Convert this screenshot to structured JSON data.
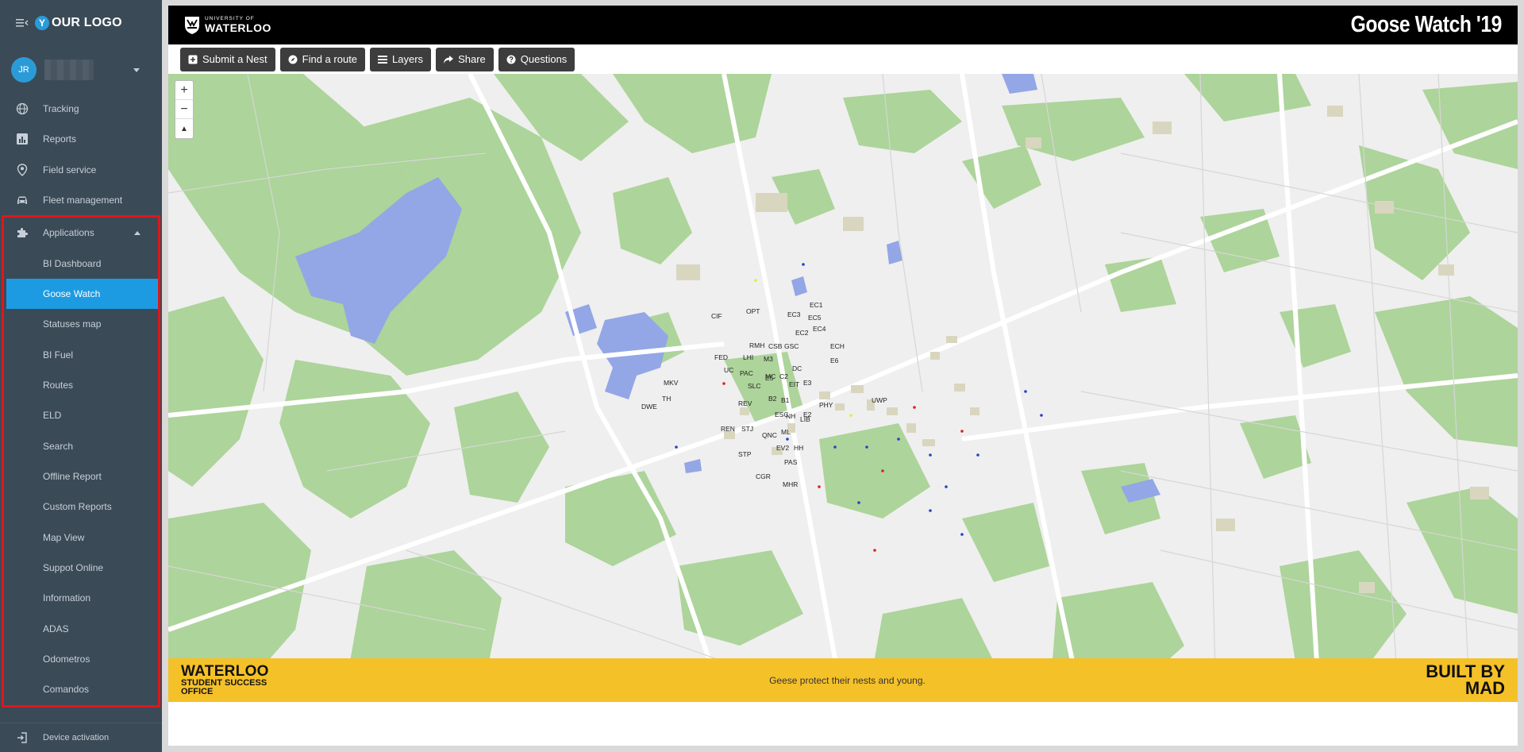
{
  "brand": {
    "logo_letter": "Y",
    "logo_text": "OUR LOGO"
  },
  "user": {
    "initials": "JR"
  },
  "nav": {
    "top_items": [
      {
        "label": "Tracking",
        "icon": "globe-icon"
      },
      {
        "label": "Reports",
        "icon": "bar-chart-icon"
      },
      {
        "label": "Field service",
        "icon": "location-pin-icon"
      },
      {
        "label": "Fleet management",
        "icon": "car-icon"
      }
    ],
    "applications": {
      "label": "Applications",
      "icon": "puzzle-icon",
      "items": [
        "BI Dashboard",
        "Goose Watch",
        "Statuses map",
        "BI Fuel",
        "Routes",
        "ELD",
        "Search",
        "Offline Report",
        "Custom Reports",
        "Map View",
        "Suppot Online",
        "Information",
        "ADAS",
        "Odometros",
        "Comandos"
      ],
      "active": "Goose Watch"
    },
    "device_activation": "Device activation"
  },
  "app": {
    "uw_small": "UNIVERSITY OF",
    "uw_big": "WATERLOO",
    "title": "Goose Watch '19",
    "toolbar": [
      {
        "label": "Submit a Nest",
        "icon": "plus-square-icon"
      },
      {
        "label": "Find a route",
        "icon": "compass-icon"
      },
      {
        "label": "Layers",
        "icon": "list-icon"
      },
      {
        "label": "Share",
        "icon": "share-icon"
      },
      {
        "label": "Questions",
        "icon": "question-circle-icon"
      }
    ],
    "zoom": {
      "in": "+",
      "out": "−",
      "reset": "▲"
    },
    "map_labels": [
      "EC1",
      "EC3",
      "EC5",
      "OPT",
      "EC2",
      "EC4",
      "CIF",
      "RMH",
      "CSB",
      "GSC",
      "ECH",
      "FED",
      "LHI",
      "M3",
      "DC",
      "E6",
      "UC",
      "PAC",
      "MC",
      "C2",
      "E5",
      "MKV",
      "SLC",
      "EIT",
      "E3",
      "UWP",
      "TH",
      "B2",
      "B1",
      "PHY",
      "DWE",
      "REV",
      "NH",
      "LIB",
      "E2",
      "ESC",
      "REN",
      "STJ",
      "ML",
      "QNC",
      "EV2",
      "HH",
      "STP",
      "PAS",
      "CGR",
      "MHR"
    ],
    "footer": {
      "left_1": "WATERLOO",
      "left_2": "STUDENT SUCCESS",
      "left_3": "OFFICE",
      "middle": "Geese protect their nests and young.",
      "right_1": "BUILT BY",
      "right_2": "MAD"
    }
  },
  "colors": {
    "sidebar_bg": "#3b4a57",
    "active_blue": "#1d9be2",
    "highlight_red": "#e0161b",
    "footer_yellow": "#f5c129",
    "map_green": "#a9d595",
    "map_water": "#93a6e6"
  }
}
